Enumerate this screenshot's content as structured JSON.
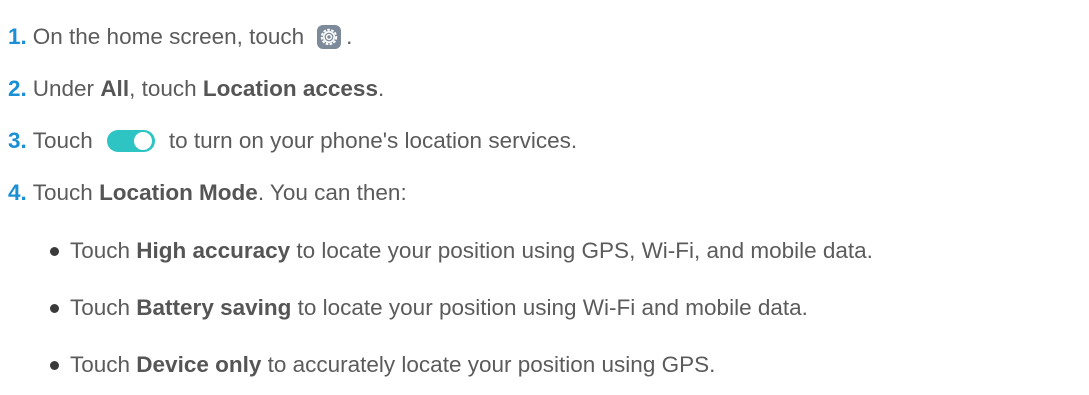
{
  "steps": [
    {
      "num": "1.",
      "before": "On the home screen, touch",
      "icon": "settings-gear-icon",
      "after": "."
    },
    {
      "num": "2.",
      "t1": "Under ",
      "b1": "All",
      "t2": ", touch ",
      "b2": "Location access",
      "t3": "."
    },
    {
      "num": "3.",
      "before": "Touch",
      "icon": "toggle-switch-on-icon",
      "after": "to turn on your phone's location services."
    },
    {
      "num": "4.",
      "t1": "Touch ",
      "b1": "Location Mode",
      "t2": ". You can then:"
    }
  ],
  "bullets": [
    {
      "t1": "Touch ",
      "b1": "High accuracy",
      "t2": " to locate your position using GPS, Wi-Fi, and mobile data."
    },
    {
      "t1": "Touch ",
      "b1": "Battery saving",
      "t2": " to locate your position using Wi-Fi and mobile data."
    },
    {
      "t1": "Touch ",
      "b1": "Device only",
      "t2": " to accurately locate your position using GPS."
    }
  ],
  "colors": {
    "step_number": "#1b8fd6",
    "text": "#5b5b5b",
    "toggle_on": "#2ec4c4",
    "gear_icon": "#7d8a99"
  }
}
